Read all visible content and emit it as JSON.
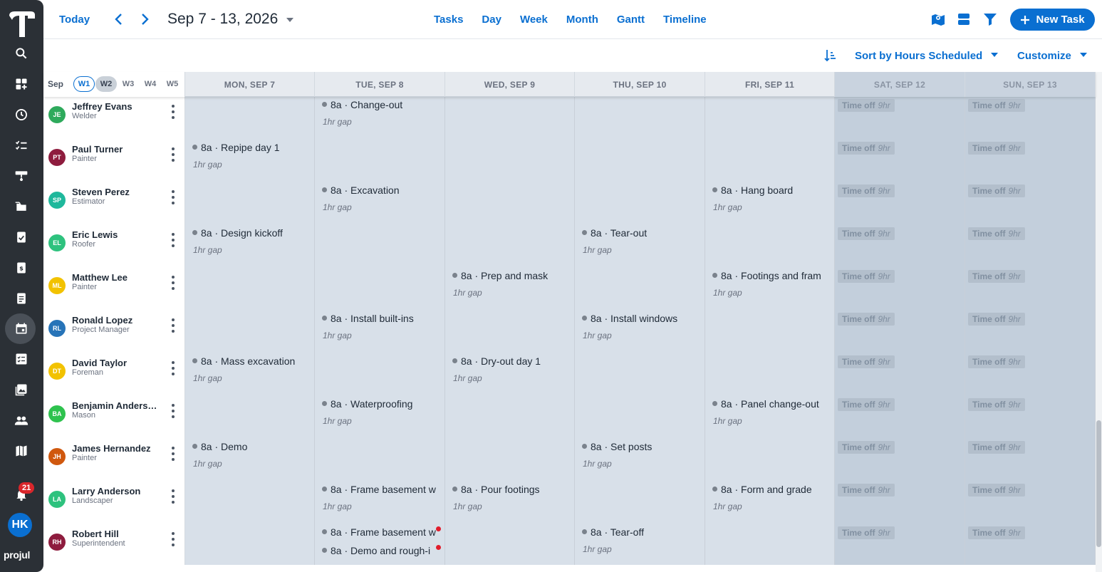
{
  "rail": {
    "brand": "projul",
    "notification_count": "21",
    "user_initials": "HK",
    "icons": [
      "search-icon",
      "dashboard-icon",
      "clock-icon",
      "checklist-icon",
      "paint-roller-icon",
      "folder-icon",
      "estimate-icon",
      "invoice-icon",
      "document-icon",
      "calendar-icon",
      "task-list-icon",
      "photos-icon",
      "people-icon",
      "map-icon",
      "bell-icon"
    ]
  },
  "toolbar": {
    "today_label": "Today",
    "date_range": "Sep 7 - 13, 2026",
    "views": [
      "Tasks",
      "Day",
      "Week",
      "Month",
      "Gantt",
      "Timeline"
    ],
    "new_task_label": "New Task"
  },
  "sortbar": {
    "sort_label": "Sort by Hours Scheduled",
    "customize_label": "Customize"
  },
  "week_selector": {
    "month": "Sep",
    "weeks": [
      "W1",
      "W2",
      "W3",
      "W4",
      "W5"
    ]
  },
  "days": [
    "MON, SEP 7",
    "TUE, SEP 8",
    "WED, SEP 9",
    "THU, SEP 10",
    "FRI, SEP 11",
    "SAT, SEP 12",
    "SUN, SEP 13"
  ],
  "timeoff": {
    "label": "Time off",
    "hours": "9hr"
  },
  "gap_label": "1hr gap",
  "colors": {
    "accent": "#0a6fd1",
    "cell_bg": "#d8e0e9",
    "weekend_bg": "#c3cfdc",
    "alert": "#e11d2c"
  },
  "people": [
    {
      "initials": "JE",
      "name": "Jeffrey Evans",
      "role": "Welder",
      "color": "#2eaa5c",
      "tasks": [
        {
          "day": 1,
          "label": "8a · Change-out"
        }
      ]
    },
    {
      "initials": "PT",
      "name": "Paul Turner",
      "role": "Painter",
      "color": "#8e1c3e",
      "tasks": [
        {
          "day": 0,
          "label": "8a · Repipe day 1"
        }
      ]
    },
    {
      "initials": "SP",
      "name": "Steven Perez",
      "role": "Estimator",
      "color": "#1fb89c",
      "tasks": [
        {
          "day": 1,
          "label": "8a · Excavation"
        },
        {
          "day": 4,
          "label": "8a · Hang board"
        }
      ]
    },
    {
      "initials": "EL",
      "name": "Eric Lewis",
      "role": "Roofer",
      "color": "#2ec27e",
      "tasks": [
        {
          "day": 0,
          "label": "8a · Design kickoff"
        },
        {
          "day": 3,
          "label": "8a · Tear-out"
        }
      ]
    },
    {
      "initials": "ML",
      "name": "Matthew Lee",
      "role": "Painter",
      "color": "#f2c200",
      "tasks": [
        {
          "day": 2,
          "label": "8a · Prep and mask"
        },
        {
          "day": 4,
          "label": "8a · Footings and fram"
        }
      ]
    },
    {
      "initials": "RL",
      "name": "Ronald Lopez",
      "role": "Project Manager",
      "color": "#2774b8",
      "tasks": [
        {
          "day": 1,
          "label": "8a · Install built-ins"
        },
        {
          "day": 3,
          "label": "8a · Install windows"
        }
      ]
    },
    {
      "initials": "DT",
      "name": "David Taylor",
      "role": "Foreman",
      "color": "#f2c200",
      "tasks": [
        {
          "day": 0,
          "label": "8a · Mass excavation"
        },
        {
          "day": 2,
          "label": "8a · Dry-out day 1"
        }
      ]
    },
    {
      "initials": "BA",
      "name": "Benjamin Anders…",
      "role": "Mason",
      "color": "#2ec24e",
      "tasks": [
        {
          "day": 1,
          "label": "8a · Waterproofing"
        },
        {
          "day": 4,
          "label": "8a · Panel change-out"
        }
      ]
    },
    {
      "initials": "JH",
      "name": "James Hernandez",
      "role": "Painter",
      "color": "#d0580e",
      "tasks": [
        {
          "day": 0,
          "label": "8a · Demo"
        },
        {
          "day": 3,
          "label": "8a · Set posts"
        }
      ]
    },
    {
      "initials": "LA",
      "name": "Larry Anderson",
      "role": "Landscaper",
      "color": "#2ec27e",
      "tasks": [
        {
          "day": 1,
          "label": "8a · Frame basement w"
        },
        {
          "day": 2,
          "label": "8a · Pour footings"
        },
        {
          "day": 4,
          "label": "8a · Form and grade"
        }
      ]
    },
    {
      "initials": "RH",
      "name": "Robert Hill",
      "role": "Superintendent",
      "color": "#8e1c3e",
      "tasks": [
        {
          "day": 1,
          "label": "8a · Frame basement w",
          "alert": true
        },
        {
          "day": 1,
          "label": "8a · Demo and rough-i",
          "alert": true,
          "second": true
        },
        {
          "day": 3,
          "label": "8a · Tear-off"
        }
      ]
    }
  ]
}
